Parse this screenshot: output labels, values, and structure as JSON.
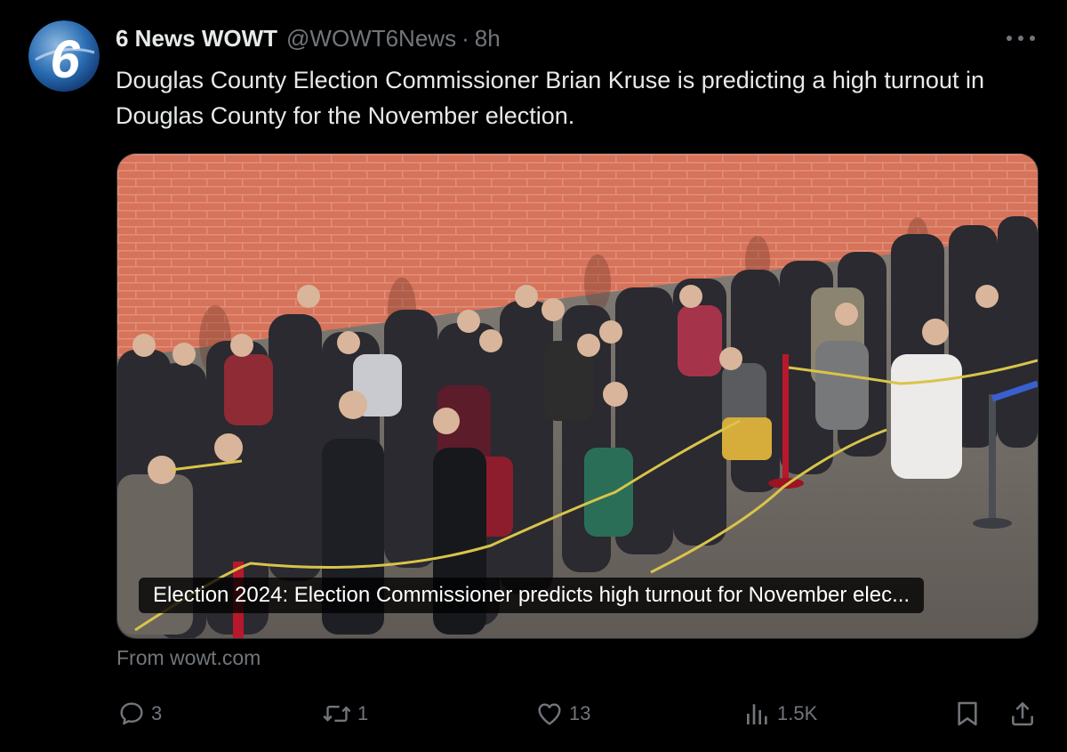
{
  "tweet": {
    "display_name": "6 News WOWT",
    "handle": "@WOWT6News",
    "separator": "·",
    "timestamp": "8h",
    "text": "Douglas County Election Commissioner Brian Kruse is predicting a high turnout in Douglas County for the November election.",
    "avatar_label": "6"
  },
  "card": {
    "caption": "Election 2024: Election Commissioner predicts high turnout for November elec...",
    "source": "From wowt.com"
  },
  "actions": {
    "replies": "3",
    "reposts": "1",
    "likes": "13",
    "views": "1.5K"
  },
  "colors": {
    "background": "#000000",
    "text_primary": "#e7e9ea",
    "text_secondary": "#71767b"
  },
  "icons": [
    "more-icon",
    "reply-icon",
    "repost-icon",
    "like-icon",
    "views-icon",
    "bookmark-icon",
    "share-icon"
  ]
}
